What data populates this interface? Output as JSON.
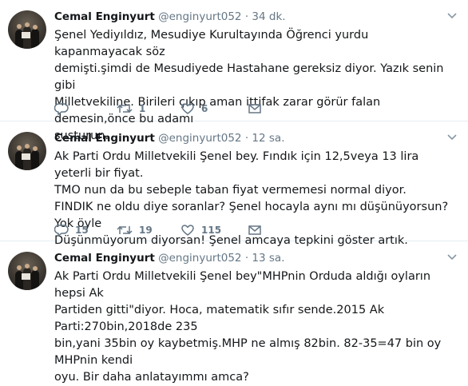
{
  "tweets": [
    {
      "name": "Cemal Enginyurt",
      "handle": "@enginyurt052",
      "dot": "·",
      "time": "34 dk.",
      "text": "Şenel Yediyıldız, Mesudiye Kurultayında Öğrenci yurdu kapanmayacak söz\ndemişti.şimdi de Mesudiyede Hastahane gereksiz diyor. Yazık senin gibi\nMilletvekiline. Birileri çıkıp aman ittifak zarar görür falan demesin,önce bu adamı\nsusturun.",
      "replies": "",
      "retweets": "1",
      "likes": "6"
    },
    {
      "name": "Cemal Enginyurt",
      "handle": "@enginyurt052",
      "dot": "·",
      "time": "12 sa.",
      "text": "Ak Parti Ordu Milletvekili Şenel bey. Fındık için 12,5veya 13 lira yeterli bir fiyat.\nTMO nun da bu sebeple taban fiyat vermemesi normal diyor.\nFINDIK ne oldu diye soranlar? Şenel hocayla aynı mı düşünüyorsun? Yok öyle\nDüşünmüyorum diyorsan! Şenel amcaya tepkini göster artık.",
      "replies": "15",
      "retweets": "19",
      "likes": "115"
    },
    {
      "name": "Cemal Enginyurt",
      "handle": "@enginyurt052",
      "dot": "·",
      "time": "13 sa.",
      "text": "Ak Parti Ordu Milletvekili Şenel bey\"MHPnin Orduda aldığı oyların hepsi Ak\nPartiden gitti\"diyor. Hoca, matematik sıfır sende.2015 Ak Parti:270bin,2018de 235\nbin,yani 35bin oy kaybetmiş.MHP ne almış 82bin. 82-35=47 bin oy MHPnin kendi\noyu. Bir daha anlatayımmı amca?",
      "replies": "",
      "retweets": "",
      "likes": ""
    }
  ],
  "icons": {
    "reply": "reply-icon",
    "retweet": "retweet-icon",
    "like": "heart-icon",
    "dm": "envelope-icon",
    "caret": "chevron-down-icon"
  },
  "colors": {
    "icon_gray": "#657786",
    "border": "#e6ecf0",
    "text": "#14171a"
  }
}
